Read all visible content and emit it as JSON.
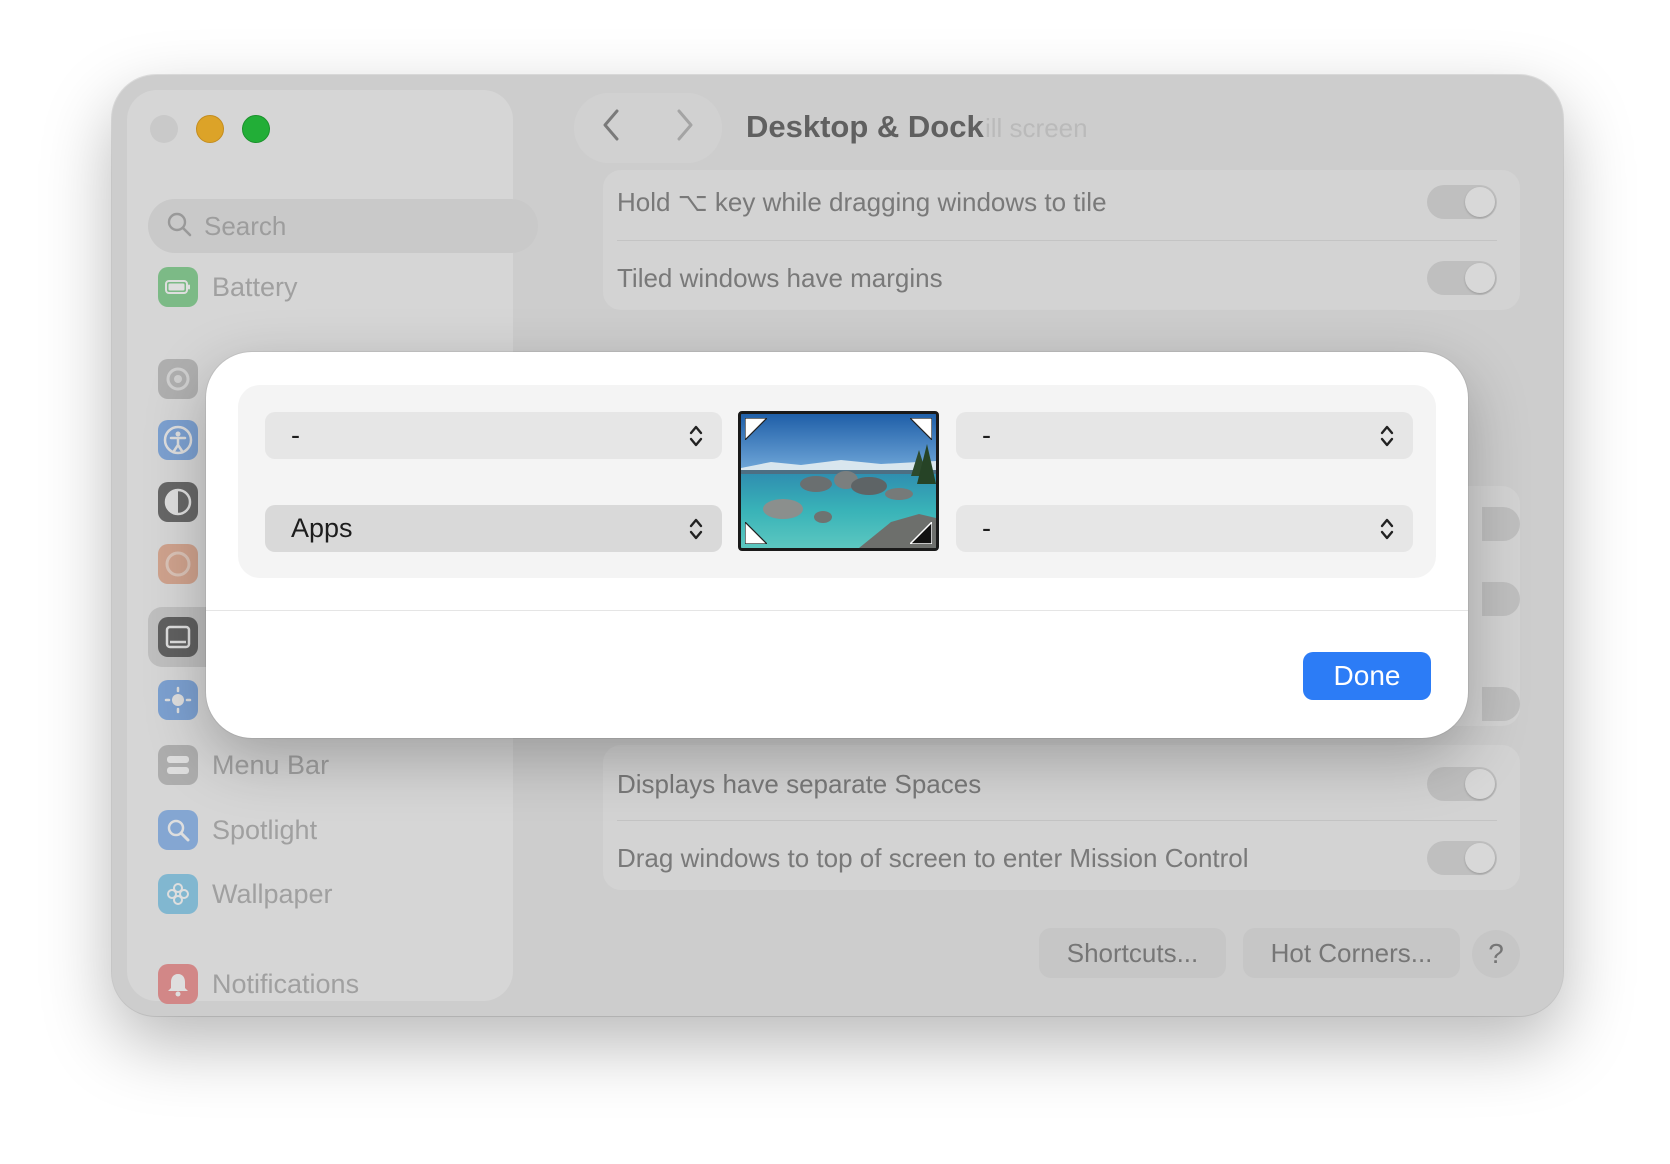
{
  "window": {
    "title": "Desktop & Dock",
    "title_ghost": "ill screen"
  },
  "sidebar": {
    "search_placeholder": "Search",
    "items": [
      {
        "label": "Battery",
        "icon": "battery-icon",
        "color": "#5bc76a"
      },
      {
        "label": "Menu Bar",
        "icon": "menu-bar-icon",
        "color": "#9b9b9b"
      },
      {
        "label": "Spotlight",
        "icon": "spotlight-icon",
        "color": "#5a9bf2"
      },
      {
        "label": "Wallpaper",
        "icon": "wallpaper-icon",
        "color": "#54b6e4"
      },
      {
        "label": "Notifications",
        "icon": "notifications-icon",
        "color": "#ee5a5a"
      }
    ],
    "icon_only": [
      {
        "icon": "general-gear-icon",
        "color": "#a8a8a8"
      },
      {
        "icon": "accessibility-icon",
        "color": "#4a90e8"
      },
      {
        "icon": "appearance-icon",
        "color": "#3c3c3c"
      },
      {
        "icon": "apple-intelligence-icon",
        "color": "#e88f6a"
      },
      {
        "icon": "desktop-dock-icon",
        "color": "#3a3a3a"
      },
      {
        "icon": "displays-icon",
        "color": "#4a90e8"
      }
    ]
  },
  "settings": {
    "rows": [
      {
        "label": "Hold ⌥ key while dragging windows to tile"
      },
      {
        "label": "Tiled windows have margins"
      },
      {
        "label": "Displays have separate Spaces"
      },
      {
        "label": "Drag windows to top of screen to enter Mission Control"
      }
    ],
    "buttons": {
      "shortcuts": "Shortcuts...",
      "hot_corners": "Hot Corners...",
      "help": "?"
    }
  },
  "hot_corners_sheet": {
    "top_left": "-",
    "top_right": "-",
    "bottom_left": "Apps",
    "bottom_right": "-",
    "done": "Done"
  },
  "colors": {
    "accent": "#2c7cf6"
  }
}
